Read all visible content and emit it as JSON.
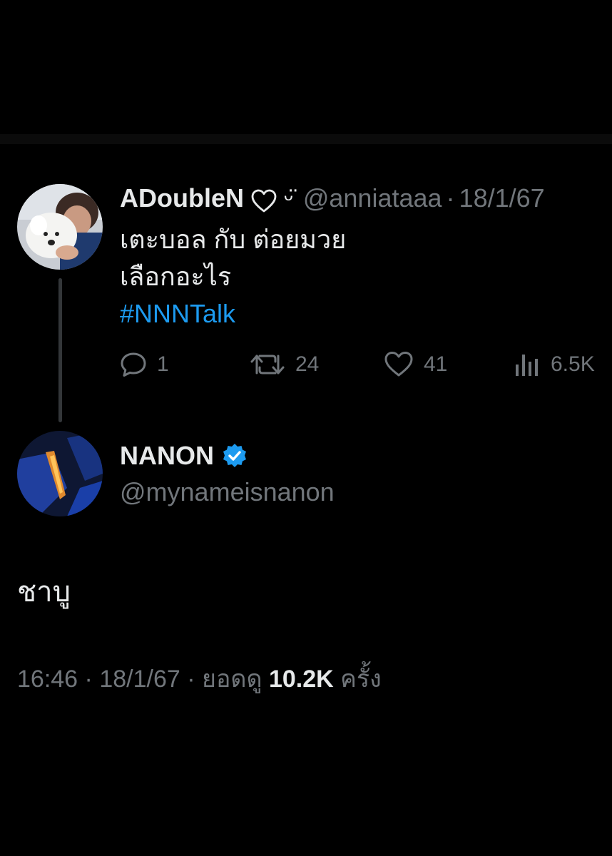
{
  "reply_to": {
    "display_name": "ADoubleN",
    "heart_icon": "heart-outline-icon",
    "emoticon": "ᵕ̈",
    "handle": "@anniataaa",
    "separator": "·",
    "date": "18/1/67",
    "text_line_1": "เตะบอล กับ ต่อยมวย",
    "text_line_2": "เลือกอะไร",
    "hashtag": "#NNNTalk",
    "actions": {
      "replies": "1",
      "retweets": "24",
      "likes": "41",
      "views": "6.5K"
    }
  },
  "author": {
    "display_name": "NANON",
    "verified": true,
    "handle": "@mynameisnanon"
  },
  "tweet": {
    "text": "ชาบู",
    "time": "16:46",
    "separator": "·",
    "date": "18/1/67",
    "views_prefix": "ยอดดู",
    "views_count": "10.2K",
    "views_suffix": "ครั้ง"
  },
  "colors": {
    "background": "#000000",
    "primary_text": "#e7e9ea",
    "secondary_text": "#71767b",
    "link": "#1d9bf0",
    "verified": "#1d9bf0"
  }
}
